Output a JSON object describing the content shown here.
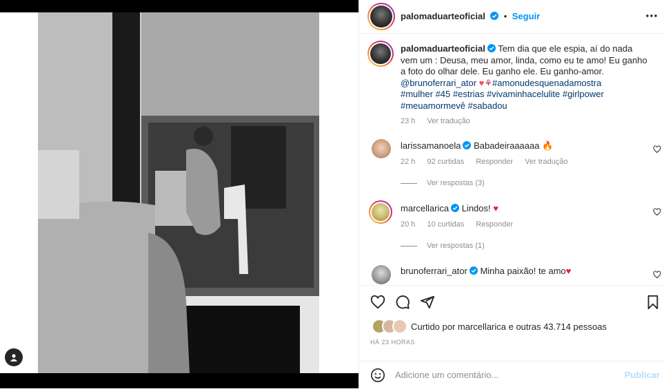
{
  "post": {
    "author": "palomaduarteoficial",
    "follow_label": "Seguir",
    "caption_lines": [
      "Tem dia que ele espia, aí do nada",
      "vem um : Deusa, meu amor, linda, como eu te amo! Eu ganho",
      "a foto do olhar dele. Eu ganho ele. Eu ganho-amor."
    ],
    "caption_mention": "@brunoferrari_ator",
    "caption_tags_1": "#amonudesquenadamostra",
    "caption_tags_2": "#mulher #45 #estrias #vivaminhacelulite #girlpower",
    "caption_tags_3": "#meuamormevê #sabadou",
    "caption_time": "23 h",
    "caption_translate": "Ver tradução"
  },
  "comments": [
    {
      "user": "larissamanoela",
      "text": "Babadeiraaaaaa",
      "time": "22 h",
      "likes": "92 curtidas",
      "reply": "Responder",
      "translate": "Ver tradução",
      "replies": "Ver respostas (3)"
    },
    {
      "user": "marcellarica",
      "text": "Lindos!",
      "time": "20 h",
      "likes": "10 curtidas",
      "reply": "Responder",
      "replies": "Ver respostas (1)"
    },
    {
      "user": "brunoferrari_ator",
      "text": "Minha paixão! te amo"
    }
  ],
  "likes_text": "Curtido por marcellarica e outras 43.714 pessoas",
  "timestamp": "HÁ 23 HORAS",
  "add_comment": {
    "placeholder": "Adicione um comentário...",
    "post_label": "Publicar"
  },
  "icons": [
    "like-icon",
    "comment-icon",
    "share-icon",
    "save-icon",
    "emoji-icon",
    "more-icon",
    "verified-icon",
    "user-tag-icon"
  ],
  "colors": {
    "accent": "#0095f6",
    "link": "#00376b",
    "heart": "#ed4956",
    "muted": "#8e8e8e"
  }
}
